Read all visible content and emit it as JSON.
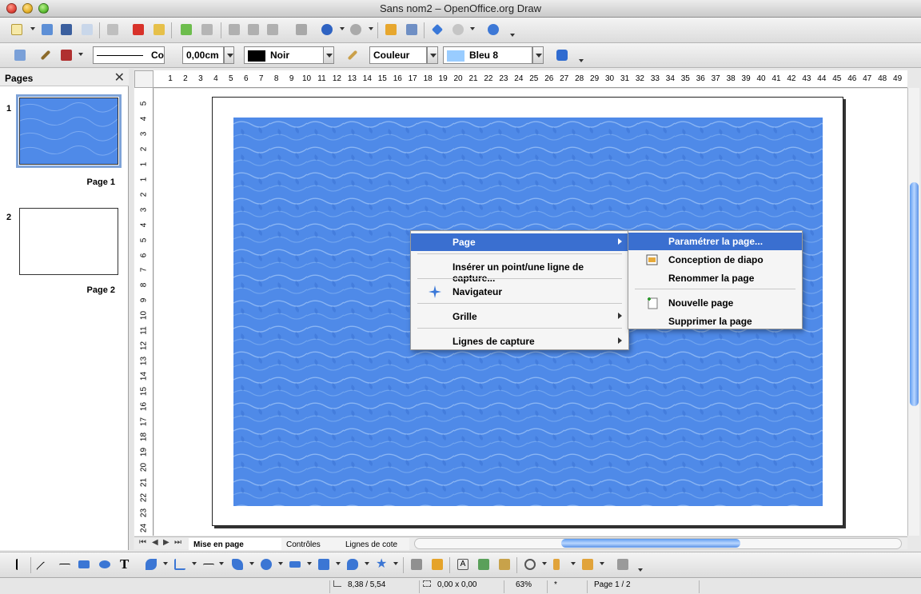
{
  "window": {
    "title": "Sans nom2 – OpenOffice.org Draw"
  },
  "toolbar2": {
    "line_style_value": "Co",
    "line_width_value": "0,00cm",
    "line_color_value": "Noir",
    "line_color_hex": "#000000",
    "area_style_value": "Couleur",
    "area_color_value": "Bleu 8",
    "area_color_hex": "#99ccff"
  },
  "pages_panel": {
    "title": "Pages",
    "close_glyph": "✕",
    "pages": [
      {
        "number": "1",
        "label": "Page 1"
      },
      {
        "number": "2",
        "label": "Page 2"
      }
    ]
  },
  "rulers": {
    "horizontal": [
      "1",
      "2",
      "3",
      "4",
      "5",
      "6",
      "7",
      "8",
      "9",
      "10",
      "11",
      "12",
      "13",
      "14",
      "15",
      "16",
      "17",
      "18",
      "19",
      "20",
      "21",
      "22",
      "23",
      "24",
      "25",
      "26",
      "27",
      "28",
      "29",
      "30",
      "31",
      "32",
      "33",
      "34",
      "35",
      "36",
      "37",
      "38",
      "39",
      "40",
      "41",
      "42",
      "43",
      "44",
      "45",
      "46",
      "47",
      "48",
      "49"
    ],
    "vertical": [
      "5",
      "4",
      "3",
      "2",
      "1",
      "1",
      "2",
      "3",
      "4",
      "5",
      "6",
      "7",
      "8",
      "9",
      "10",
      "11",
      "12",
      "13",
      "14",
      "15",
      "16",
      "17",
      "18",
      "19",
      "20",
      "21",
      "22",
      "23",
      "24"
    ]
  },
  "sheet_tabs": {
    "nav": [
      "⏮",
      "◀",
      "▶",
      "⏭"
    ],
    "tabs": [
      {
        "label": "Mise en page"
      },
      {
        "label": "Contrôles"
      },
      {
        "label": "Lignes de cote"
      }
    ]
  },
  "context_menu": {
    "items": [
      {
        "label": "Page",
        "submenu": true
      },
      {
        "label": "Insérer un point/une ligne de capture...",
        "submenu": false
      },
      {
        "label": "Navigateur",
        "submenu": false,
        "icon": "navigator-icon"
      },
      {
        "label": "Grille",
        "submenu": true
      },
      {
        "label": "Lignes de capture",
        "submenu": true
      }
    ]
  },
  "page_submenu": {
    "items": [
      {
        "label": "Paramétrer la page..."
      },
      {
        "label": "Conception de diapo",
        "icon": "slide-design-icon"
      },
      {
        "label": "Renommer la page"
      },
      {
        "label": "Nouvelle page",
        "icon": "new-page-icon"
      },
      {
        "label": "Supprimer la page"
      }
    ]
  },
  "statusbar": {
    "position": "8,38 / 5,54",
    "size": "0,00 x 0,00",
    "zoom": "63%",
    "modified": "*",
    "page": "Page 1 / 2"
  },
  "colors": {
    "menu_highlight": "#3a6fd0",
    "water_texture_base": "#4f8ae8"
  }
}
